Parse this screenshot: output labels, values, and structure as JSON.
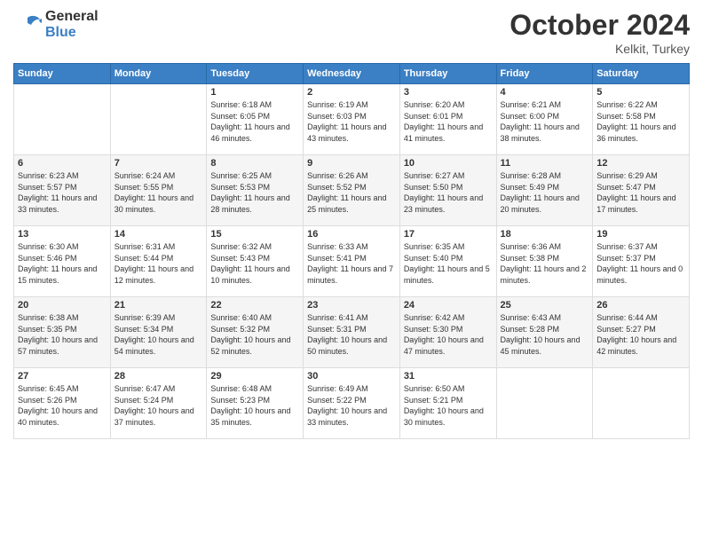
{
  "logo": {
    "general": "General",
    "blue": "Blue"
  },
  "title": "October 2024",
  "location": "Kelkit, Turkey",
  "days_header": [
    "Sunday",
    "Monday",
    "Tuesday",
    "Wednesday",
    "Thursday",
    "Friday",
    "Saturday"
  ],
  "weeks": [
    [
      {
        "day": "",
        "info": ""
      },
      {
        "day": "",
        "info": ""
      },
      {
        "day": "1",
        "info": "Sunrise: 6:18 AM\nSunset: 6:05 PM\nDaylight: 11 hours and 46 minutes."
      },
      {
        "day": "2",
        "info": "Sunrise: 6:19 AM\nSunset: 6:03 PM\nDaylight: 11 hours and 43 minutes."
      },
      {
        "day": "3",
        "info": "Sunrise: 6:20 AM\nSunset: 6:01 PM\nDaylight: 11 hours and 41 minutes."
      },
      {
        "day": "4",
        "info": "Sunrise: 6:21 AM\nSunset: 6:00 PM\nDaylight: 11 hours and 38 minutes."
      },
      {
        "day": "5",
        "info": "Sunrise: 6:22 AM\nSunset: 5:58 PM\nDaylight: 11 hours and 36 minutes."
      }
    ],
    [
      {
        "day": "6",
        "info": "Sunrise: 6:23 AM\nSunset: 5:57 PM\nDaylight: 11 hours and 33 minutes."
      },
      {
        "day": "7",
        "info": "Sunrise: 6:24 AM\nSunset: 5:55 PM\nDaylight: 11 hours and 30 minutes."
      },
      {
        "day": "8",
        "info": "Sunrise: 6:25 AM\nSunset: 5:53 PM\nDaylight: 11 hours and 28 minutes."
      },
      {
        "day": "9",
        "info": "Sunrise: 6:26 AM\nSunset: 5:52 PM\nDaylight: 11 hours and 25 minutes."
      },
      {
        "day": "10",
        "info": "Sunrise: 6:27 AM\nSunset: 5:50 PM\nDaylight: 11 hours and 23 minutes."
      },
      {
        "day": "11",
        "info": "Sunrise: 6:28 AM\nSunset: 5:49 PM\nDaylight: 11 hours and 20 minutes."
      },
      {
        "day": "12",
        "info": "Sunrise: 6:29 AM\nSunset: 5:47 PM\nDaylight: 11 hours and 17 minutes."
      }
    ],
    [
      {
        "day": "13",
        "info": "Sunrise: 6:30 AM\nSunset: 5:46 PM\nDaylight: 11 hours and 15 minutes."
      },
      {
        "day": "14",
        "info": "Sunrise: 6:31 AM\nSunset: 5:44 PM\nDaylight: 11 hours and 12 minutes."
      },
      {
        "day": "15",
        "info": "Sunrise: 6:32 AM\nSunset: 5:43 PM\nDaylight: 11 hours and 10 minutes."
      },
      {
        "day": "16",
        "info": "Sunrise: 6:33 AM\nSunset: 5:41 PM\nDaylight: 11 hours and 7 minutes."
      },
      {
        "day": "17",
        "info": "Sunrise: 6:35 AM\nSunset: 5:40 PM\nDaylight: 11 hours and 5 minutes."
      },
      {
        "day": "18",
        "info": "Sunrise: 6:36 AM\nSunset: 5:38 PM\nDaylight: 11 hours and 2 minutes."
      },
      {
        "day": "19",
        "info": "Sunrise: 6:37 AM\nSunset: 5:37 PM\nDaylight: 11 hours and 0 minutes."
      }
    ],
    [
      {
        "day": "20",
        "info": "Sunrise: 6:38 AM\nSunset: 5:35 PM\nDaylight: 10 hours and 57 minutes."
      },
      {
        "day": "21",
        "info": "Sunrise: 6:39 AM\nSunset: 5:34 PM\nDaylight: 10 hours and 54 minutes."
      },
      {
        "day": "22",
        "info": "Sunrise: 6:40 AM\nSunset: 5:32 PM\nDaylight: 10 hours and 52 minutes."
      },
      {
        "day": "23",
        "info": "Sunrise: 6:41 AM\nSunset: 5:31 PM\nDaylight: 10 hours and 50 minutes."
      },
      {
        "day": "24",
        "info": "Sunrise: 6:42 AM\nSunset: 5:30 PM\nDaylight: 10 hours and 47 minutes."
      },
      {
        "day": "25",
        "info": "Sunrise: 6:43 AM\nSunset: 5:28 PM\nDaylight: 10 hours and 45 minutes."
      },
      {
        "day": "26",
        "info": "Sunrise: 6:44 AM\nSunset: 5:27 PM\nDaylight: 10 hours and 42 minutes."
      }
    ],
    [
      {
        "day": "27",
        "info": "Sunrise: 6:45 AM\nSunset: 5:26 PM\nDaylight: 10 hours and 40 minutes."
      },
      {
        "day": "28",
        "info": "Sunrise: 6:47 AM\nSunset: 5:24 PM\nDaylight: 10 hours and 37 minutes."
      },
      {
        "day": "29",
        "info": "Sunrise: 6:48 AM\nSunset: 5:23 PM\nDaylight: 10 hours and 35 minutes."
      },
      {
        "day": "30",
        "info": "Sunrise: 6:49 AM\nSunset: 5:22 PM\nDaylight: 10 hours and 33 minutes."
      },
      {
        "day": "31",
        "info": "Sunrise: 6:50 AM\nSunset: 5:21 PM\nDaylight: 10 hours and 30 minutes."
      },
      {
        "day": "",
        "info": ""
      },
      {
        "day": "",
        "info": ""
      }
    ]
  ]
}
